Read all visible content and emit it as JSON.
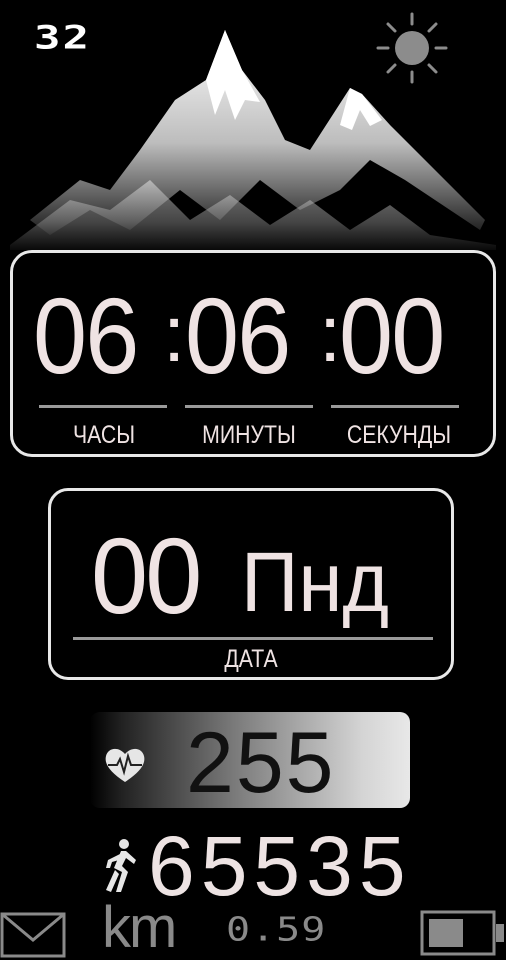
{
  "top": {
    "number": "32",
    "weather_icon": "sun-icon"
  },
  "time": {
    "hours": "06",
    "minutes": "06",
    "seconds": "00",
    "separator": ":",
    "labels": {
      "hours": "ЧАСЫ",
      "minutes": "МИНУТЫ",
      "seconds": "СЕКУНДЫ"
    }
  },
  "date": {
    "day": "00",
    "weekday": "Пнд",
    "label": "ДАТА"
  },
  "heart_rate": {
    "value": "255",
    "icon": "heart-pulse-icon"
  },
  "steps": {
    "value": "65535",
    "icon": "walker-icon"
  },
  "distance": {
    "unit": "km",
    "value": "0.59"
  },
  "status": {
    "mail_icon": "mail-icon",
    "battery_icon": "battery-icon"
  }
}
